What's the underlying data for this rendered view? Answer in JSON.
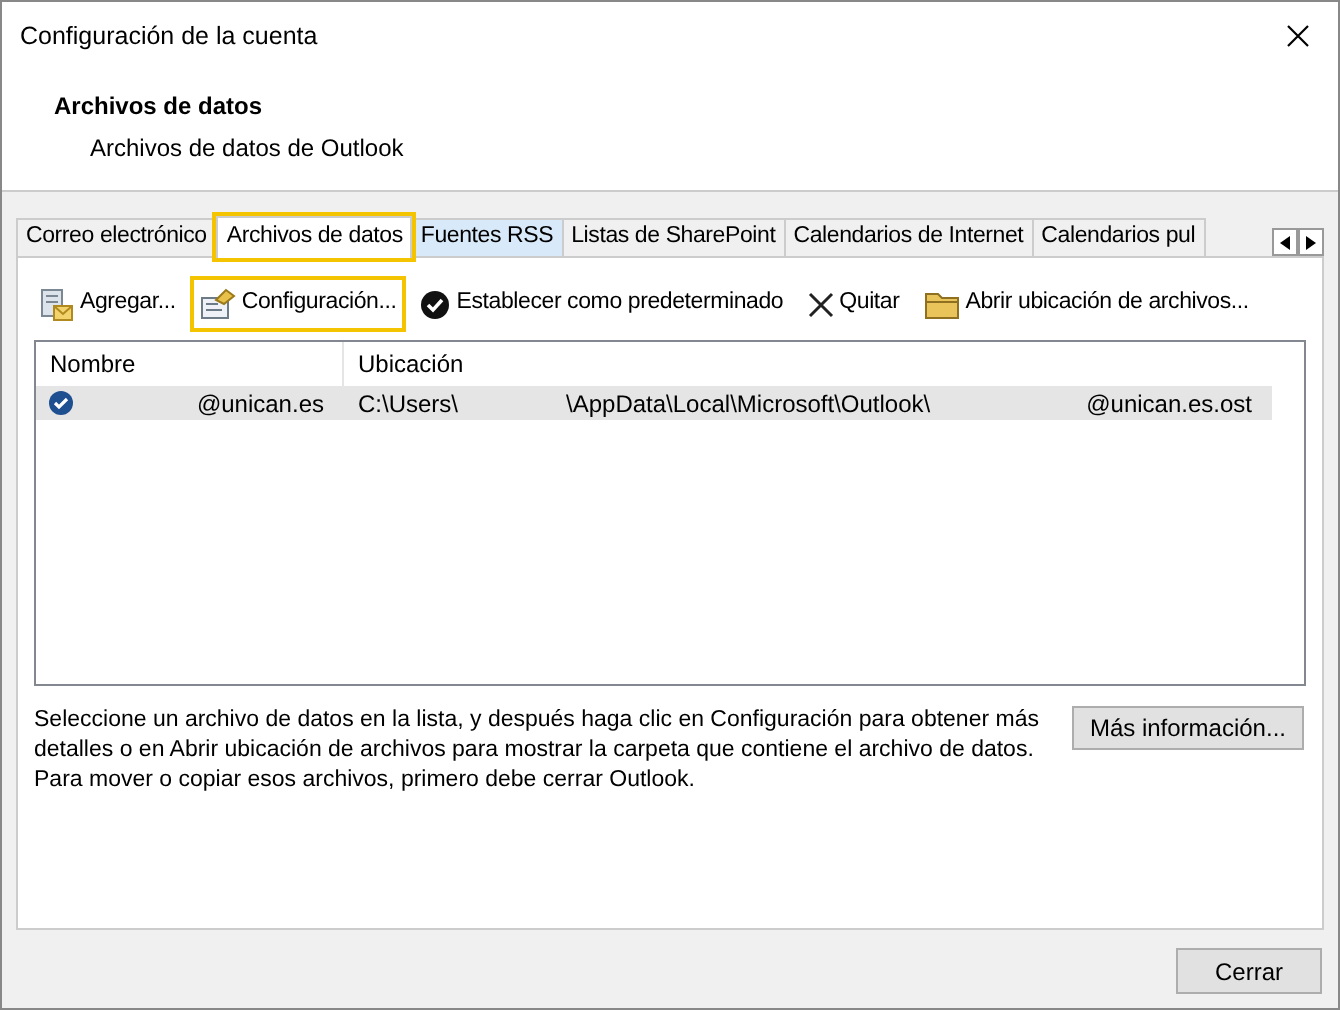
{
  "window": {
    "title": "Configuración de la cuenta"
  },
  "header": {
    "title": "Archivos de datos",
    "subtitle": "Archivos de datos de Outlook"
  },
  "tabs": [
    {
      "label": "Correo electrónico",
      "selected": false,
      "highlighted": false,
      "hover": false
    },
    {
      "label": "Archivos de datos",
      "selected": true,
      "highlighted": true,
      "hover": false
    },
    {
      "label": "Fuentes RSS",
      "selected": false,
      "highlighted": false,
      "hover": true
    },
    {
      "label": "Listas de SharePoint",
      "selected": false,
      "highlighted": false,
      "hover": false
    },
    {
      "label": "Calendarios de Internet",
      "selected": false,
      "highlighted": false,
      "hover": false
    },
    {
      "label": "Calendarios pul",
      "selected": false,
      "highlighted": false,
      "hover": false
    }
  ],
  "toolbar": [
    {
      "kind": "add",
      "label": "Agregar...",
      "highlighted": false
    },
    {
      "kind": "settings",
      "label": "Configuración...",
      "highlighted": true
    },
    {
      "kind": "default",
      "label": "Establecer como predeterminado",
      "highlighted": false
    },
    {
      "kind": "remove",
      "label": "Quitar",
      "highlighted": false
    },
    {
      "kind": "folder",
      "label": "Abrir ubicación de archivos...",
      "highlighted": false
    }
  ],
  "table": {
    "columns": [
      "Nombre",
      "Ubicación"
    ],
    "rows": [
      {
        "default": true,
        "selected": true,
        "name": "@unican.es",
        "location": [
          "C:\\Users\\",
          "\\AppData\\Local\\Microsoft\\Outlook\\",
          "@unican.es.ost"
        ]
      }
    ]
  },
  "description": "Seleccione un archivo de datos en la lista, y después haga clic en Configuración para obtener más detalles o en Abrir ubicación de archivos para mostrar la carpeta que contiene el archivo de datos. Para mover o copiar esos archivos, primero debe cerrar Outlook.",
  "more_info_button": "Más información...",
  "close_button": "Cerrar"
}
